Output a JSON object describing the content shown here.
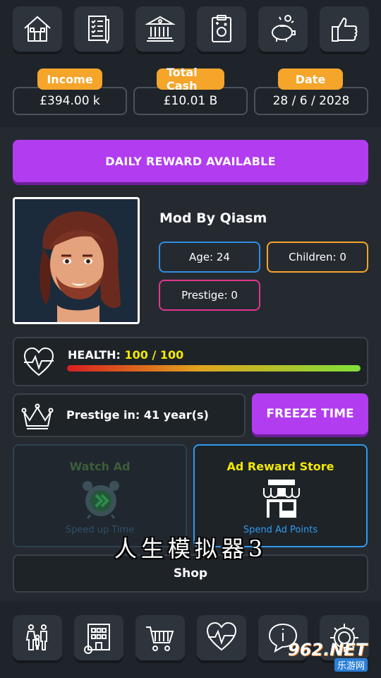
{
  "top_nav": {
    "icons": [
      "home-icon",
      "checklist-icon",
      "bank-icon",
      "clipboard-icon",
      "piggy-bank-icon",
      "thumbs-up-icon"
    ]
  },
  "stats": {
    "income_label": "Income",
    "income_value": "£394.00 k",
    "cash_label": "Total Cash",
    "cash_value": "£10.01 B",
    "date_label": "Date",
    "date_value": "28 / 6 / 2028"
  },
  "daily_reward": {
    "label": "DAILY REWARD AVAILABLE"
  },
  "player": {
    "name": "Mod By Qiasm",
    "age": "Age: 24",
    "children": "Children: 0",
    "prestige": "Prestige: 0"
  },
  "health": {
    "label": "HEALTH:",
    "value": "100 / 100",
    "fraction": 1.0
  },
  "prestige_timer": {
    "text": "Prestige in: 41 year(s)",
    "freeze_label": "FREEZE TIME"
  },
  "cards": {
    "watch_ad_title": "Watch Ad",
    "watch_ad_sub": "Speed up Time",
    "store_title": "Ad Reward Store",
    "store_sub": "Spend Ad Points"
  },
  "watermark": "人生模拟器3",
  "shop": {
    "label": "Shop"
  },
  "bottom_nav": {
    "icons": [
      "family-icon",
      "building-icon",
      "shopping-cart-icon",
      "heart-icon",
      "info-icon",
      "settings-icon"
    ]
  },
  "site_badge": {
    "number": "962.NET",
    "label": "乐游网"
  },
  "colors": {
    "accent_purple": "#b23cf0",
    "tag_orange": "#f5a52a",
    "age_border": "#2f8ee0",
    "children_border": "#f5a52a",
    "prestige_border": "#e0368f",
    "health_value": "#f2e900",
    "store_border": "#2f9bf0",
    "store_title": "#f2e900"
  }
}
